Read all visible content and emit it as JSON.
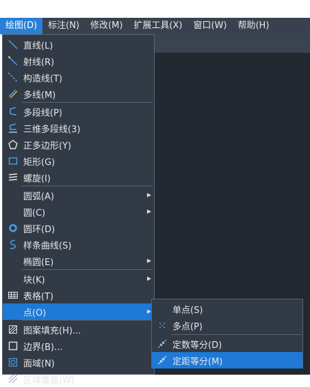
{
  "menubar": {
    "items": [
      {
        "label": "绘图(D)"
      },
      {
        "label": "标注(N)"
      },
      {
        "label": "修改(M)"
      },
      {
        "label": "扩展工具(X)"
      },
      {
        "label": "窗口(W)"
      },
      {
        "label": "帮助(H)"
      }
    ]
  },
  "draw_menu": {
    "items": [
      {
        "label": "直线(L)",
        "icon": "line-icon"
      },
      {
        "label": "射线(R)",
        "icon": "ray-icon"
      },
      {
        "label": "构造线(T)",
        "icon": "xline-icon"
      },
      {
        "label": "多线(M)",
        "icon": "multiline-icon"
      },
      {
        "label": "多段线(P)",
        "icon": "polyline-icon"
      },
      {
        "label": "三维多段线(3)",
        "icon": "3d-polyline-icon"
      },
      {
        "label": "正多边形(Y)",
        "icon": "polygon-icon"
      },
      {
        "label": "矩形(G)",
        "icon": "rectangle-icon"
      },
      {
        "label": "螺旋(I)",
        "icon": "helix-icon"
      },
      {
        "label": "圆弧(A)",
        "icon": ""
      },
      {
        "label": "圆(C)",
        "icon": ""
      },
      {
        "label": "圆环(D)",
        "icon": "donut-icon"
      },
      {
        "label": "样条曲线(S)",
        "icon": "spline-icon"
      },
      {
        "label": "椭圆(E)",
        "icon": ""
      },
      {
        "label": "块(K)",
        "icon": ""
      },
      {
        "label": "表格(T)",
        "icon": "table-icon"
      },
      {
        "label": "点(O)",
        "icon": ""
      },
      {
        "label": "图案填充(H)...",
        "icon": "hatch-icon"
      },
      {
        "label": "边界(B)...",
        "icon": "boundary-icon"
      },
      {
        "label": "面域(N)",
        "icon": "region-icon"
      },
      {
        "label": "区域覆盖(W)",
        "icon": "wipeout-icon"
      }
    ]
  },
  "point_submenu": {
    "items": [
      {
        "label": "单点(S)",
        "icon": ""
      },
      {
        "label": "多点(P)",
        "icon": "multiple-points-icon"
      },
      {
        "label": "定数等分(D)",
        "icon": "divide-icon"
      },
      {
        "label": "定距等分(M)",
        "icon": "measure-icon"
      }
    ]
  },
  "colors": {
    "menu_bg": "#323a46",
    "highlight": "#1e7ad6",
    "canvas": "#212830"
  }
}
